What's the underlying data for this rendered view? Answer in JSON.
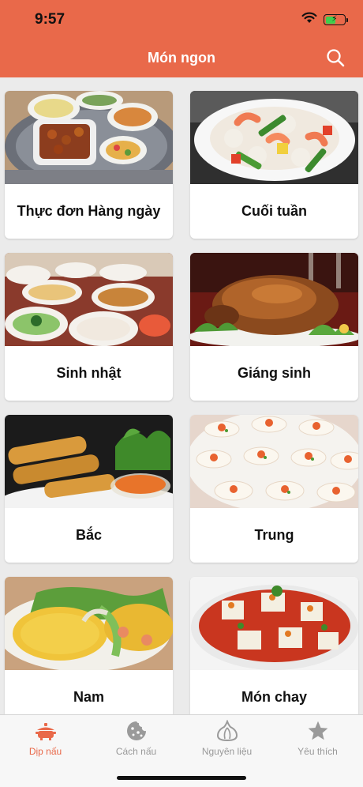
{
  "status": {
    "time": "9:57"
  },
  "header": {
    "title": "Món ngon"
  },
  "cards": [
    {
      "label": "Thực đơn Hàng ngày"
    },
    {
      "label": "Cuối tuần"
    },
    {
      "label": "Sinh nhật"
    },
    {
      "label": "Giáng sinh"
    },
    {
      "label": "Bắc"
    },
    {
      "label": "Trung"
    },
    {
      "label": "Nam"
    },
    {
      "label": "Món chay"
    }
  ],
  "tabs": [
    {
      "label": "Dịp nấu",
      "icon": "cooking-pot-icon",
      "active": true
    },
    {
      "label": "Cách nấu",
      "icon": "cookie-icon",
      "active": false
    },
    {
      "label": "Nguyên liệu",
      "icon": "garlic-icon",
      "active": false
    },
    {
      "label": "Yêu thích",
      "icon": "star-icon",
      "active": false
    }
  ],
  "colors": {
    "accent": "#e9694a",
    "inactive_tab": "#999999",
    "battery": "#3fce4d"
  }
}
